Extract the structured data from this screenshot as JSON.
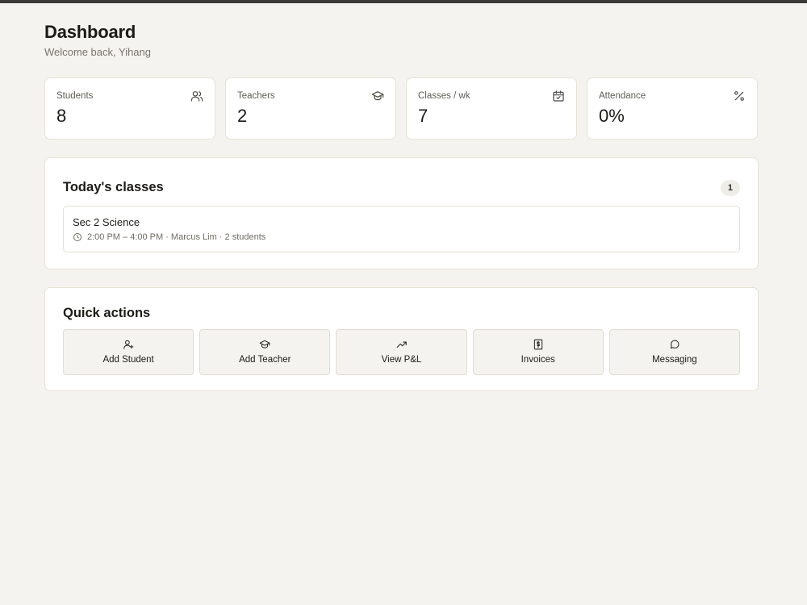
{
  "header": {
    "title": "Dashboard",
    "subtitle": "Welcome back, Yihang"
  },
  "stats": [
    {
      "label": "Students",
      "value": "8",
      "icon": "users-icon"
    },
    {
      "label": "Teachers",
      "value": "2",
      "icon": "graduation-cap-icon"
    },
    {
      "label": "Classes / wk",
      "value": "7",
      "icon": "calendar-check-icon"
    },
    {
      "label": "Attendance",
      "value": "0%",
      "icon": "percent-icon"
    }
  ],
  "today": {
    "title": "Today's classes",
    "count": "1",
    "classes": [
      {
        "name": "Sec 2 Science",
        "meta": "2:00 PM – 4:00 PM · Marcus Lim · 2 students",
        "icon": "clock-icon"
      }
    ]
  },
  "quick_actions": {
    "title": "Quick actions",
    "items": [
      {
        "label": "Add Student",
        "icon": "user-plus-icon"
      },
      {
        "label": "Add Teacher",
        "icon": "graduation-cap-icon"
      },
      {
        "label": "View P&L",
        "icon": "trending-up-icon"
      },
      {
        "label": "Invoices",
        "icon": "receipt-dollar-icon"
      },
      {
        "label": "Messaging",
        "icon": "message-circle-icon"
      }
    ]
  },
  "colors": {
    "background": "#f4f3ef",
    "card": "#ffffff",
    "border": "#e6e2d6",
    "text": "#1c1b17",
    "muted": "#77746c"
  }
}
